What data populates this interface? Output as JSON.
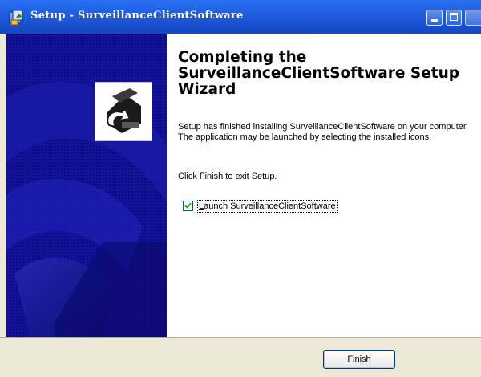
{
  "window": {
    "title": "Setup - SurveillanceClientSoftware"
  },
  "titlebar_buttons": {
    "minimize_icon": "minimize-icon",
    "maximize_icon": "maximize-icon",
    "close_icon": "close-icon"
  },
  "content": {
    "heading": "Completing the SurveillanceClientSoftware Setup Wizard",
    "body": "Setup has finished installing SurveillanceClientSoftware on your computer. The application may be launched by selecting the installed icons.",
    "exit_text": "Click Finish to exit Setup."
  },
  "launch_checkbox": {
    "checked": true,
    "label_access_key": "L",
    "label_rest": "aunch SurveillanceClientSoftware"
  },
  "buttons": {
    "finish_access_key": "F",
    "finish_rest": "inish"
  },
  "colors": {
    "titlebar": "#1f5fe0",
    "banner": "#0f0f86",
    "dialog_face": "#ece9d8",
    "button_border": "#003c74"
  }
}
